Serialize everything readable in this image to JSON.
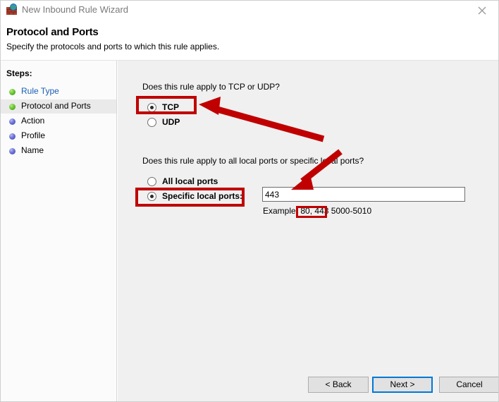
{
  "window": {
    "title": "New Inbound Rule Wizard",
    "icon": "firewall-globe-icon",
    "close_label": "✕"
  },
  "header": {
    "title": "Protocol and Ports",
    "subtitle": "Specify the protocols and ports to which this rule applies."
  },
  "sidebar": {
    "heading": "Steps:",
    "items": [
      {
        "label": "Rule Type",
        "state": "done",
        "current": false,
        "link": true
      },
      {
        "label": "Protocol and Ports",
        "state": "done",
        "current": true,
        "link": false
      },
      {
        "label": "Action",
        "state": "pending",
        "current": false,
        "link": false
      },
      {
        "label": "Profile",
        "state": "pending",
        "current": false,
        "link": false
      },
      {
        "label": "Name",
        "state": "pending",
        "current": false,
        "link": false
      }
    ]
  },
  "main": {
    "protocol_question": "Does this rule apply to TCP or UDP?",
    "protocol_options": [
      {
        "label": "TCP",
        "selected": true
      },
      {
        "label": "UDP",
        "selected": false
      }
    ],
    "ports_question": "Does this rule apply to all local ports or specific local ports?",
    "ports_options": [
      {
        "label": "All local ports",
        "selected": false
      },
      {
        "label": "Specific local ports:",
        "selected": true
      }
    ],
    "ports_input_value": "443",
    "ports_input_placeholder": "",
    "example_label": "Example:",
    "example_highlight": "80, 443",
    "example_tail": "5000-5010"
  },
  "footer": {
    "back_label": "< Back",
    "next_label": "Next >",
    "cancel_label": "Cancel"
  },
  "annotations": {
    "accent_color": "#c00000",
    "focus_color": "#0078d7",
    "boxes": [
      "tcp-radio",
      "specific-local-ports-radio",
      "example-ports"
    ],
    "arrows": [
      "arrow-to-tcp",
      "arrow-to-ports-input"
    ]
  }
}
